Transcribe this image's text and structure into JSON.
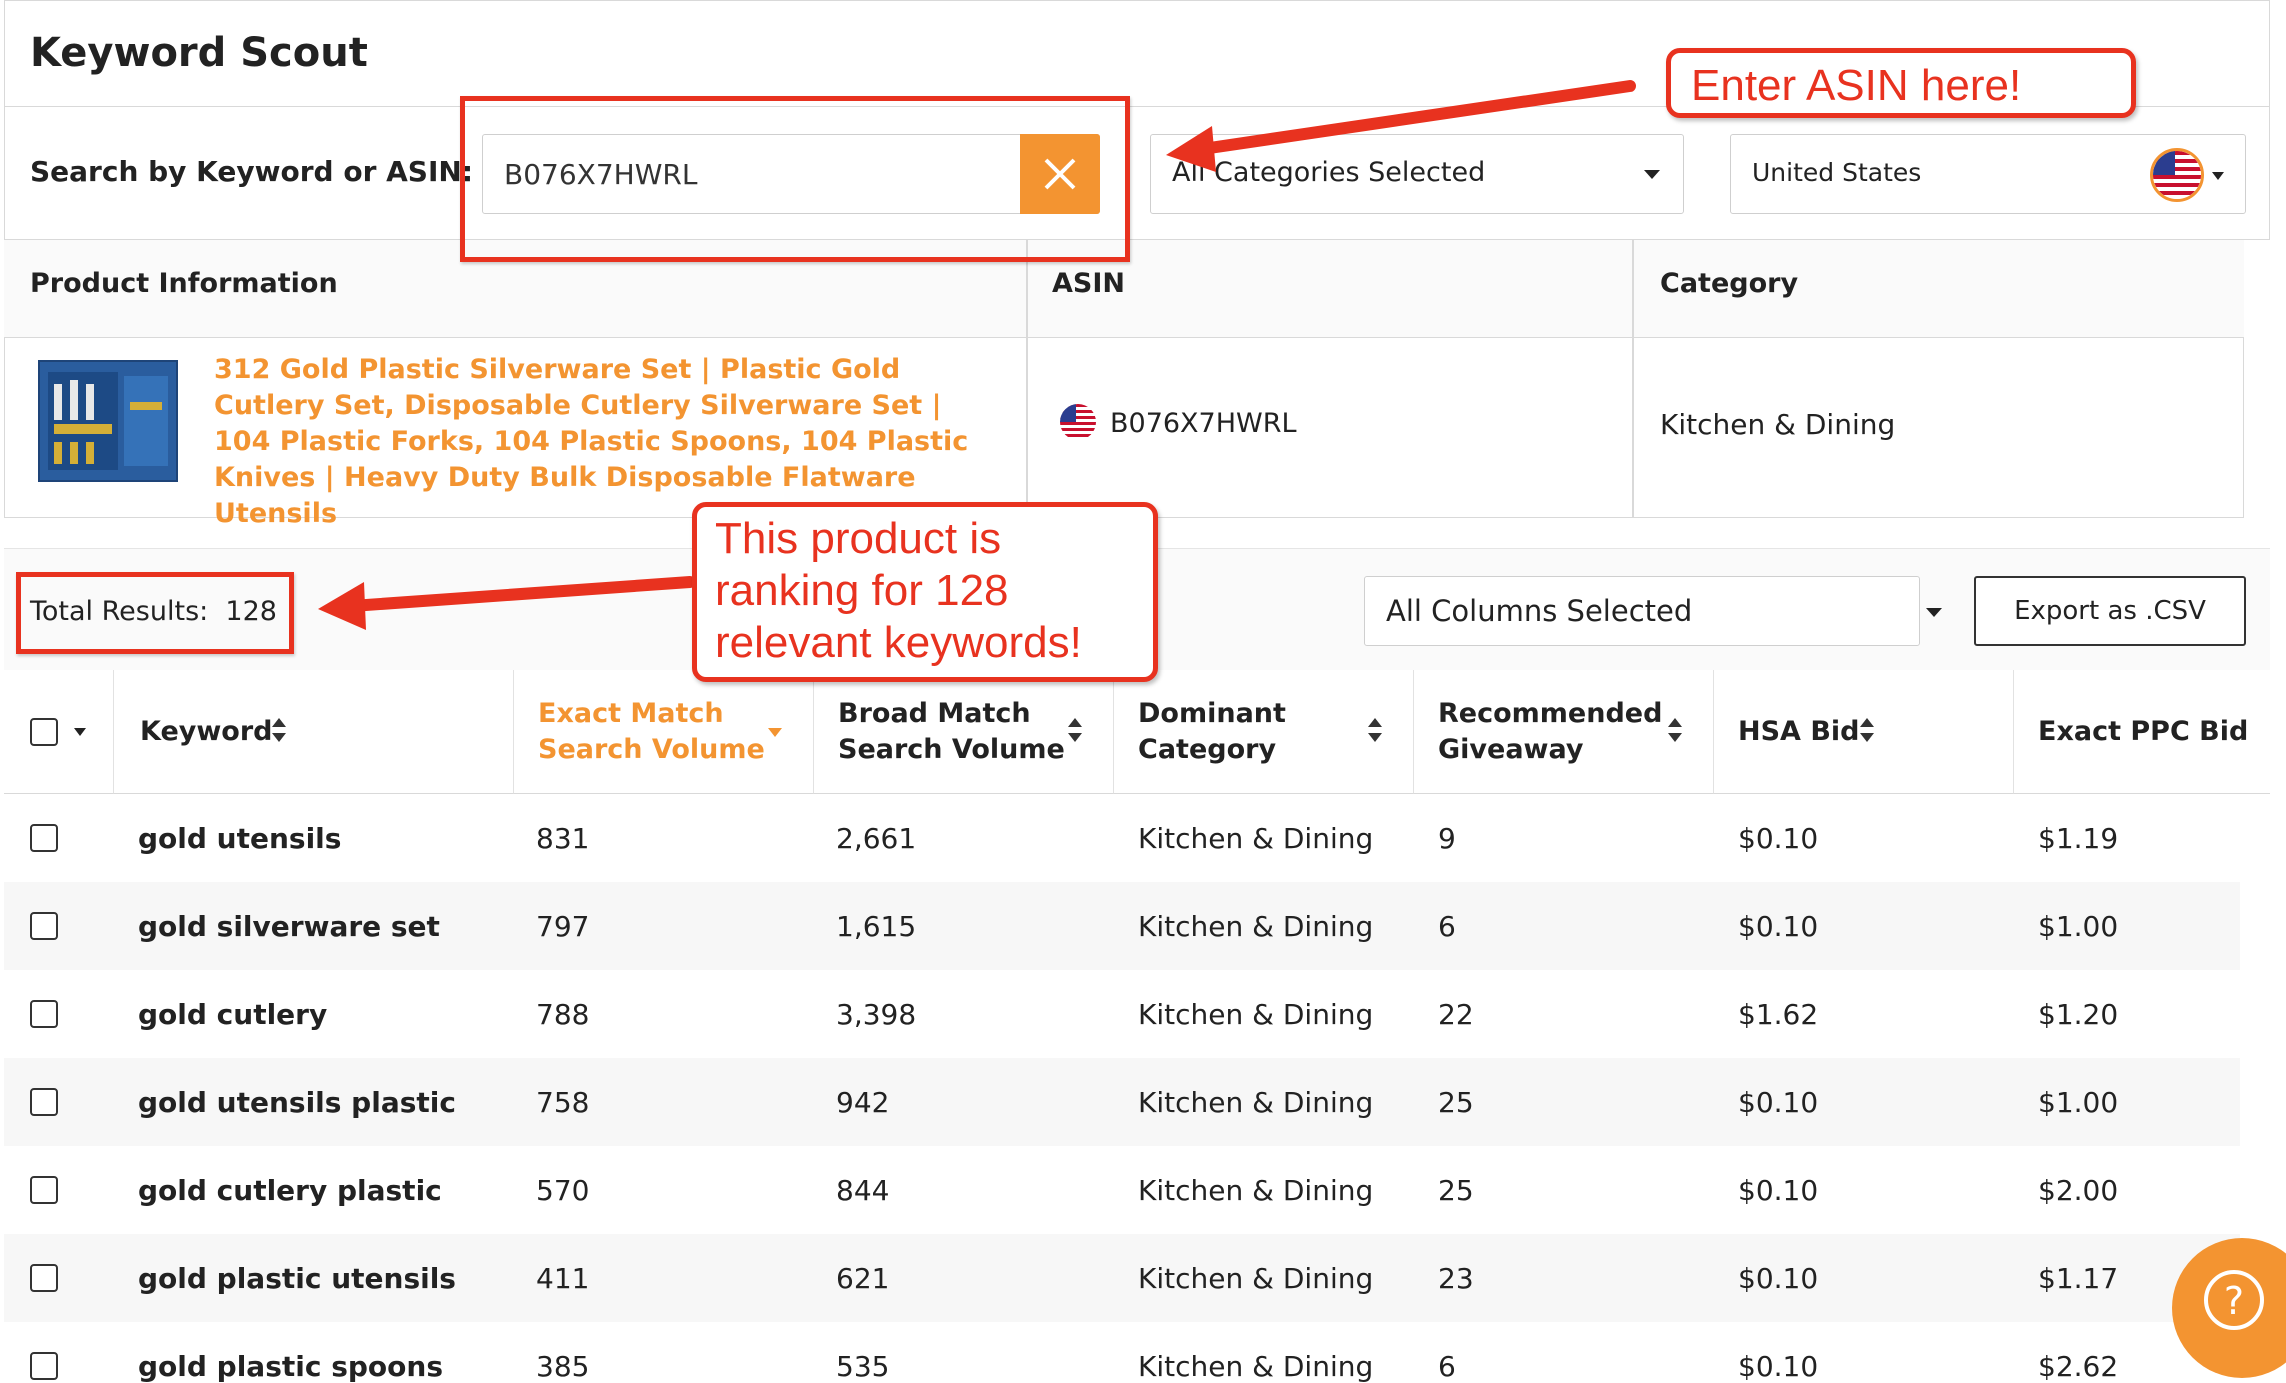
{
  "app": {
    "title": "Keyword Scout"
  },
  "search": {
    "label": "Search by Keyword or ASIN:",
    "value": "B076X7HWRL",
    "category_filter": "All Categories Selected",
    "country": "United States"
  },
  "product_panel": {
    "headers": {
      "product": "Product Information",
      "asin": "ASIN",
      "category": "Category"
    },
    "product_title": "312 Gold Plastic Silverware Set | Plastic Gold Cutlery Set, Disposable Cutlery Silverware Set | 104 Plastic Forks, 104 Plastic Spoons, 104 Plastic Knives | Heavy Duty Bulk Disposable Flatware Utensils",
    "asin": "B076X7HWRL",
    "category": "Kitchen & Dining"
  },
  "results": {
    "total_label": "Total Results:",
    "total_count": "128",
    "columns_filter": "All Columns Selected",
    "export_label": "Export as .CSV"
  },
  "table": {
    "headers": {
      "keyword": "Keyword",
      "exact_line1": "Exact Match",
      "exact_line2": "Search Volume",
      "broad_line1": "Broad Match",
      "broad_line2": "Search Volume",
      "dominant_line1": "Dominant",
      "dominant_line2": "Category",
      "giveaway_line1": "Recommended",
      "giveaway_line2": "Giveaway",
      "hsa": "HSA Bid",
      "ppc": "Exact PPC Bid"
    },
    "rows": [
      {
        "keyword": "gold utensils",
        "exact": "831",
        "broad": "2,661",
        "category": "Kitchen & Dining",
        "giveaway": "9",
        "hsa": "$0.10",
        "ppc": "$1.19"
      },
      {
        "keyword": "gold silverware set",
        "exact": "797",
        "broad": "1,615",
        "category": "Kitchen & Dining",
        "giveaway": "6",
        "hsa": "$0.10",
        "ppc": "$1.00"
      },
      {
        "keyword": "gold cutlery",
        "exact": "788",
        "broad": "3,398",
        "category": "Kitchen & Dining",
        "giveaway": "22",
        "hsa": "$1.62",
        "ppc": "$1.20"
      },
      {
        "keyword": "gold utensils plastic",
        "exact": "758",
        "broad": "942",
        "category": "Kitchen & Dining",
        "giveaway": "25",
        "hsa": "$0.10",
        "ppc": "$1.00"
      },
      {
        "keyword": "gold cutlery plastic",
        "exact": "570",
        "broad": "844",
        "category": "Kitchen & Dining",
        "giveaway": "25",
        "hsa": "$0.10",
        "ppc": "$2.00"
      },
      {
        "keyword": "gold plastic utensils",
        "exact": "411",
        "broad": "621",
        "category": "Kitchen & Dining",
        "giveaway": "23",
        "hsa": "$0.10",
        "ppc": "$1.17"
      },
      {
        "keyword": "gold plastic spoons",
        "exact": "385",
        "broad": "535",
        "category": "Kitchen & Dining",
        "giveaway": "6",
        "hsa": "$0.10",
        "ppc": "$2.62"
      }
    ]
  },
  "annotations": {
    "asin_callout": "Enter ASIN here!",
    "ranking_callout_line1": "This product is",
    "ranking_callout_line2": "ranking for 128",
    "ranking_callout_line3": "relevant keywords!"
  },
  "colors": {
    "accent": "#f39431",
    "annotation": "#e8321f"
  },
  "icons": {
    "clear": "close-icon",
    "help": "help-icon",
    "flag": "us-flag-icon"
  }
}
